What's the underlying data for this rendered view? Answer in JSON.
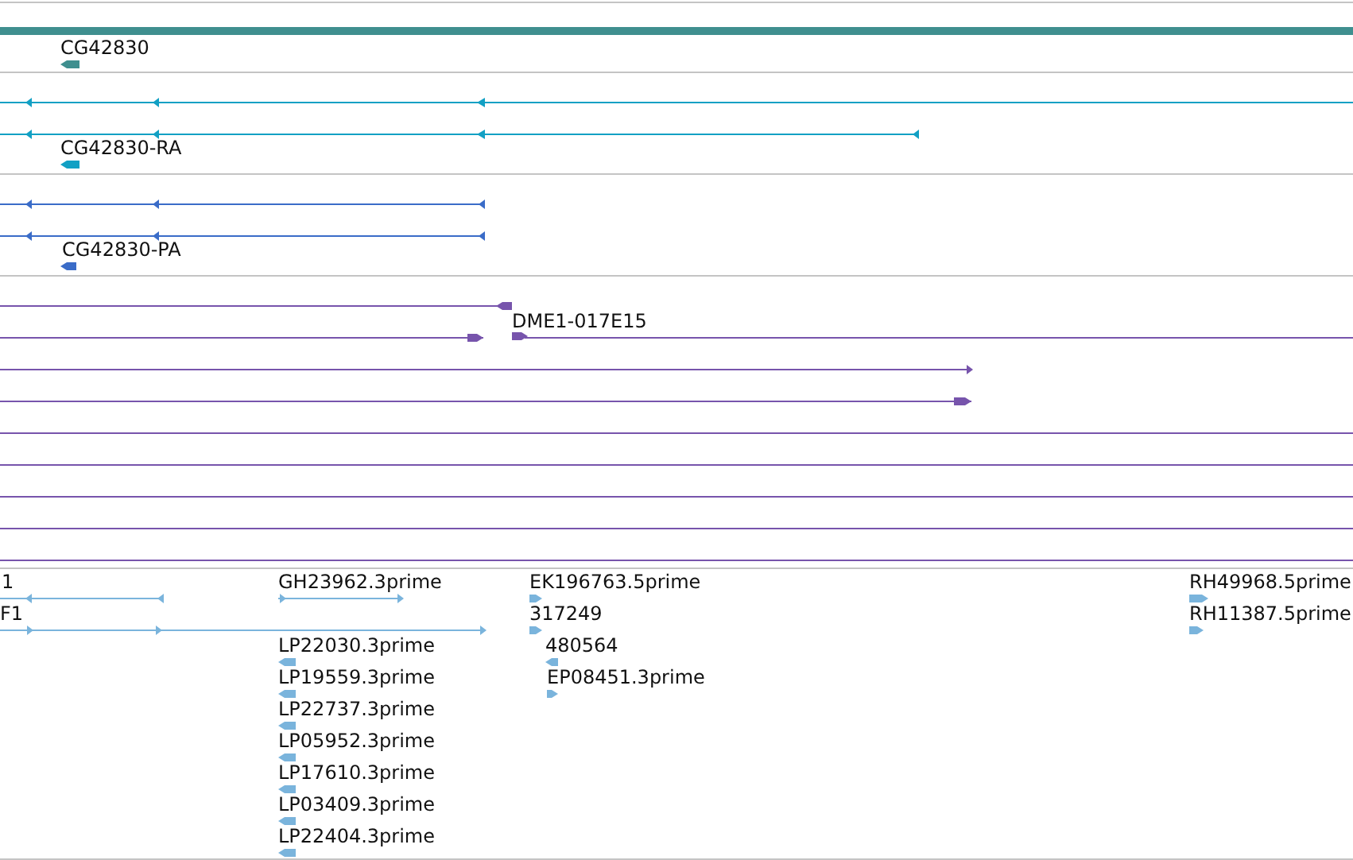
{
  "tracks": [
    {
      "kind": "gene",
      "color": "#3f8f8f",
      "features": [
        {
          "label": "CG42830",
          "reverse": true
        }
      ]
    },
    {
      "kind": "transcript",
      "color": "#12a0c4",
      "features": [
        {
          "label": "CG42830-RA",
          "reverse": true
        }
      ]
    },
    {
      "kind": "protein",
      "color": "#3a6cc8",
      "features": [
        {
          "label": "CG42830-PA",
          "reverse": true
        }
      ]
    },
    {
      "kind": "clone",
      "color": "#7754ac",
      "features": [
        {
          "label": "DME1-017E15",
          "reverse": false
        }
      ]
    },
    {
      "kind": "est",
      "color": "#7ab4dc",
      "features": [
        {
          "label": "1",
          "reverse": true
        },
        {
          "label": "F1",
          "reverse": false
        },
        {
          "label": "GH23962.3prime",
          "reverse": false
        },
        {
          "label": "EK196763.5prime",
          "reverse": false
        },
        {
          "label": "317249",
          "reverse": false
        },
        {
          "label": "480564",
          "reverse": true
        },
        {
          "label": "EP08451.3prime",
          "reverse": false
        },
        {
          "label": "LP22030.3prime",
          "reverse": true
        },
        {
          "label": "LP19559.3prime",
          "reverse": true
        },
        {
          "label": "LP22737.3prime",
          "reverse": true
        },
        {
          "label": "LP05952.3prime",
          "reverse": true
        },
        {
          "label": "LP17610.3prime",
          "reverse": true
        },
        {
          "label": "LP03409.3prime",
          "reverse": true
        },
        {
          "label": "LP22404.3prime",
          "reverse": true
        },
        {
          "label": "RH49968.5prime",
          "reverse": false
        },
        {
          "label": "RH11387.5prime",
          "reverse": false
        }
      ]
    }
  ]
}
